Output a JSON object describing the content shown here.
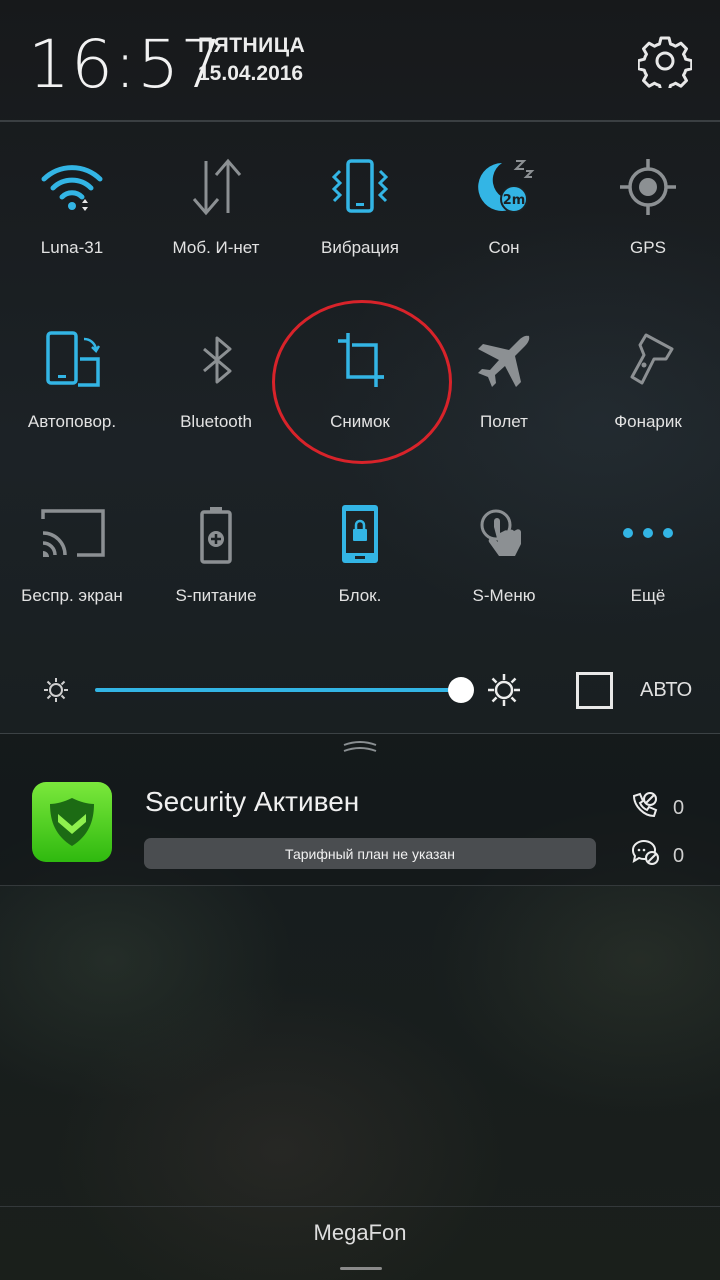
{
  "status": {
    "time": "16:57",
    "weekday": "ПЯТНИЦА",
    "date": "15.04.2016"
  },
  "toggles": [
    {
      "label": "Luna-31",
      "icon": "wifi-icon",
      "active": true
    },
    {
      "label": "Моб. И-нет",
      "icon": "mobile-data-icon",
      "active": false
    },
    {
      "label": "Вибрация",
      "icon": "vibration-icon",
      "active": true
    },
    {
      "label": "Сон",
      "icon": "sleep-icon",
      "active": true
    },
    {
      "label": "GPS",
      "icon": "gps-icon",
      "active": false
    },
    {
      "label": "Автоповор.",
      "icon": "auto-rotate-icon",
      "active": true
    },
    {
      "label": "Bluetooth",
      "icon": "bluetooth-icon",
      "active": false
    },
    {
      "label": "Снимок",
      "icon": "screenshot-crop-icon",
      "active": true
    },
    {
      "label": "Полет",
      "icon": "airplane-icon",
      "active": false
    },
    {
      "label": "Фонарик",
      "icon": "flashlight-icon",
      "active": false
    },
    {
      "label": "Беспр. экран",
      "icon": "cast-screen-icon",
      "active": false
    },
    {
      "label": "S-питание",
      "icon": "battery-saver-icon",
      "active": false
    },
    {
      "label": "Блок.",
      "icon": "lock-icon",
      "active": true
    },
    {
      "label": "S-Меню",
      "icon": "touch-menu-icon",
      "active": false
    },
    {
      "label": "Ещё",
      "icon": "more-dots-icon",
      "active": true
    }
  ],
  "sleep_badge": "2m",
  "brightness": {
    "level": 0.99,
    "auto_label": "АВТО",
    "auto_checked": false
  },
  "notification": {
    "title": "Security Активен",
    "plan": "Тарифный план не указан",
    "calls_blocked": "0",
    "sms_blocked": "0"
  },
  "carrier": "MegaFon",
  "colors": {
    "accent": "#33b5e5",
    "inactive": "#8c9093",
    "highlight": "#d8232a",
    "app_green": "#3cc61a"
  }
}
